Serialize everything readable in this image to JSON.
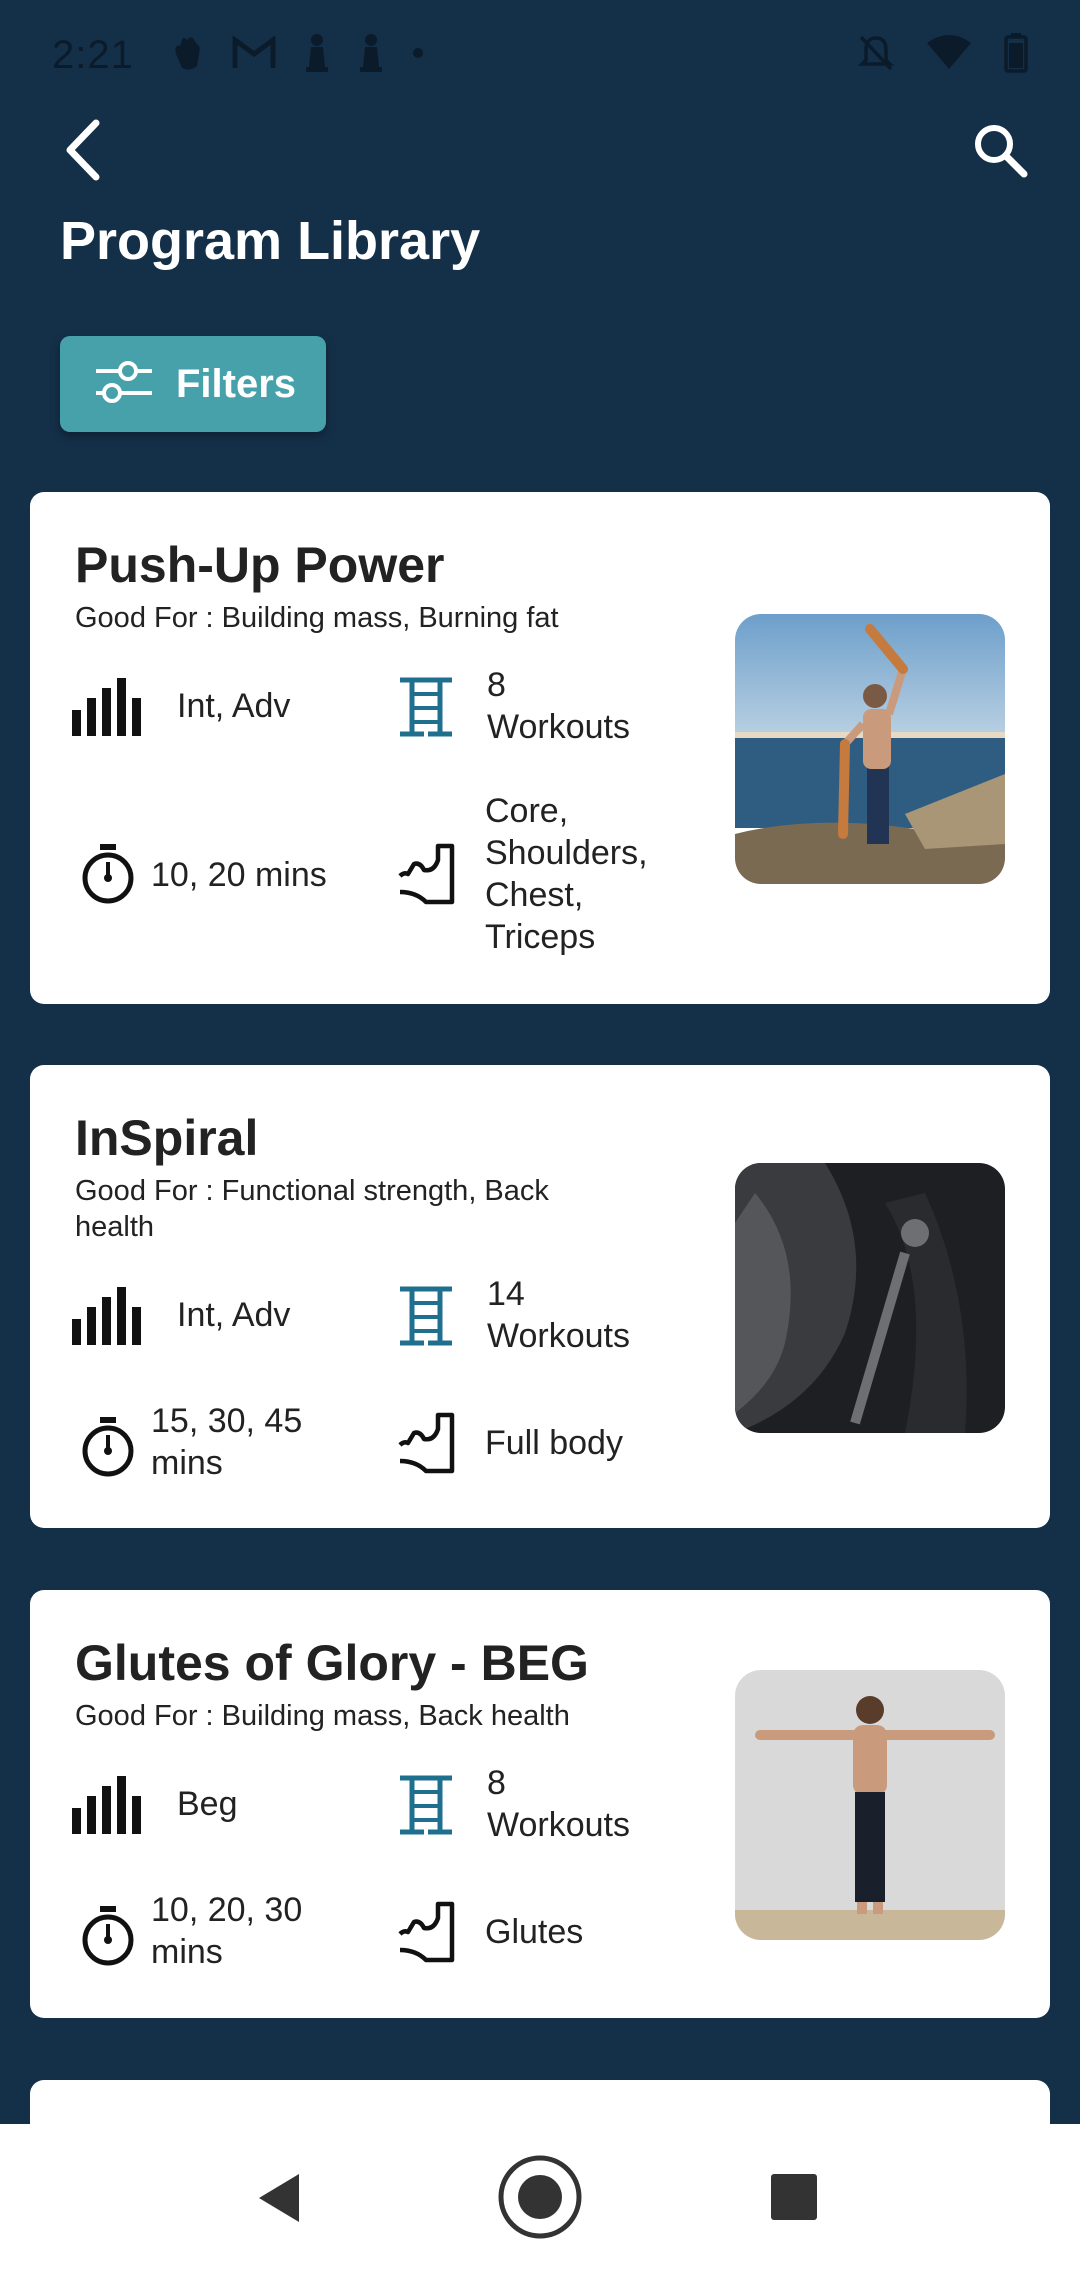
{
  "status_bar": {
    "time": "2:21"
  },
  "header": {
    "title": "Program Library"
  },
  "filters": {
    "label": "Filters"
  },
  "programs": [
    {
      "title": "Push-Up Power",
      "good_for": "Good For : Building mass, Burning fat",
      "level": "Int, Adv",
      "workouts": "8 Workouts",
      "duration": "10, 20 mins",
      "muscles": "Core, Shoulders, Chest, Triceps"
    },
    {
      "title": "InSpiral",
      "good_for": "Good For : Functional strength, Back health",
      "level": "Int, Adv",
      "workouts": "14 Workouts",
      "duration": "15, 30, 45 mins",
      "muscles": "Full body"
    },
    {
      "title": "Glutes of Glory - BEG",
      "good_for": "Good For : Building mass, Back health",
      "level": "Beg",
      "workouts": "8 Workouts",
      "duration": "10, 20, 30 mins",
      "muscles": "Glutes"
    }
  ],
  "colors": {
    "background": "#143049",
    "accent": "#47a1aa",
    "icon_teal": "#1f6f8f"
  }
}
